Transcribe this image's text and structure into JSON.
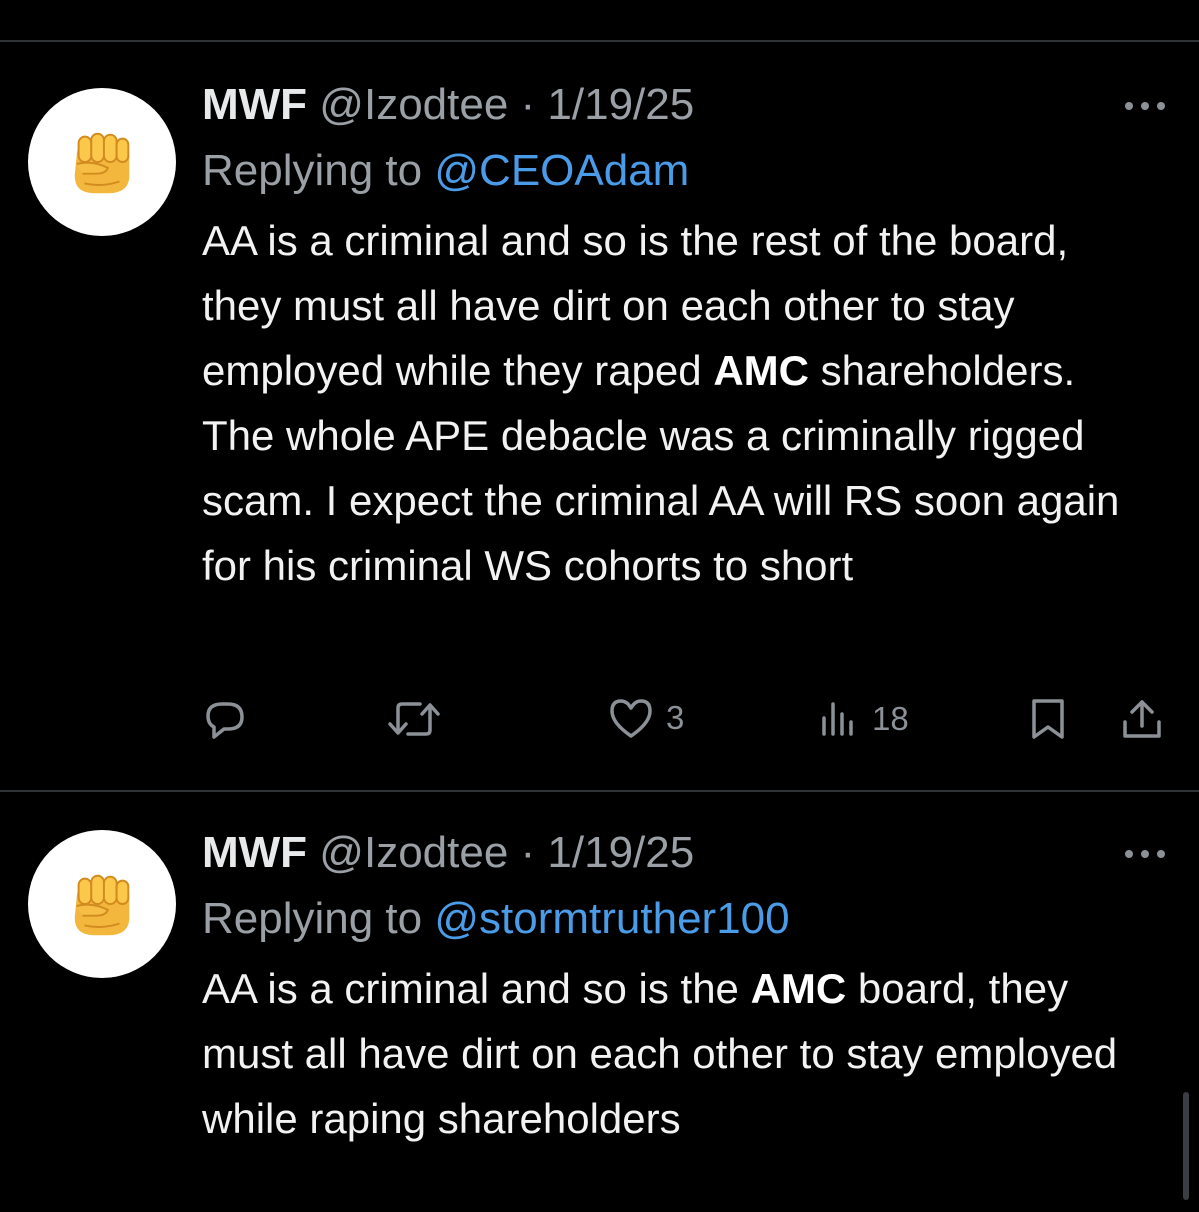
{
  "tweets": [
    {
      "name": "MWF",
      "handle": "@Izodtee",
      "separator": "·",
      "date": "1/19/25",
      "replying_prefix": "Replying to",
      "replying_to": "@CEOAdam",
      "body_segments": [
        {
          "text": "AA is a criminal and so is the rest of the board, they must all have dirt on each other to stay employed while they raped ",
          "bold": false
        },
        {
          "text": "AMC",
          "bold": true
        },
        {
          "text": " shareholders. The whole APE debacle was a criminally rigged scam. I expect the criminal AA will RS soon again for his criminal WS cohorts to short",
          "bold": false
        }
      ],
      "stats": {
        "likes": "3",
        "views": "18"
      }
    },
    {
      "name": "MWF",
      "handle": "@Izodtee",
      "separator": "·",
      "date": "1/19/25",
      "replying_prefix": "Replying to",
      "replying_to": "@stormtruther100",
      "body_segments": [
        {
          "text": "AA is a criminal and so is the ",
          "bold": false
        },
        {
          "text": "AMC",
          "bold": true
        },
        {
          "text": " board, they must all have dirt on each other to stay employed while raping shareholders",
          "bold": false
        }
      ]
    }
  ],
  "icons": {
    "avatar": "raised-fist-emoji",
    "reply": "reply-icon",
    "retweet": "retweet-icon",
    "like": "heart-icon",
    "views": "views-icon",
    "bookmark": "bookmark-icon",
    "share": "share-icon",
    "more": "more-dots-icon"
  },
  "colors": {
    "background": "#000000",
    "text": "#e7e9ea",
    "muted": "#9aa0a6",
    "link": "#4a9ce8",
    "divider": "#2f3336"
  }
}
